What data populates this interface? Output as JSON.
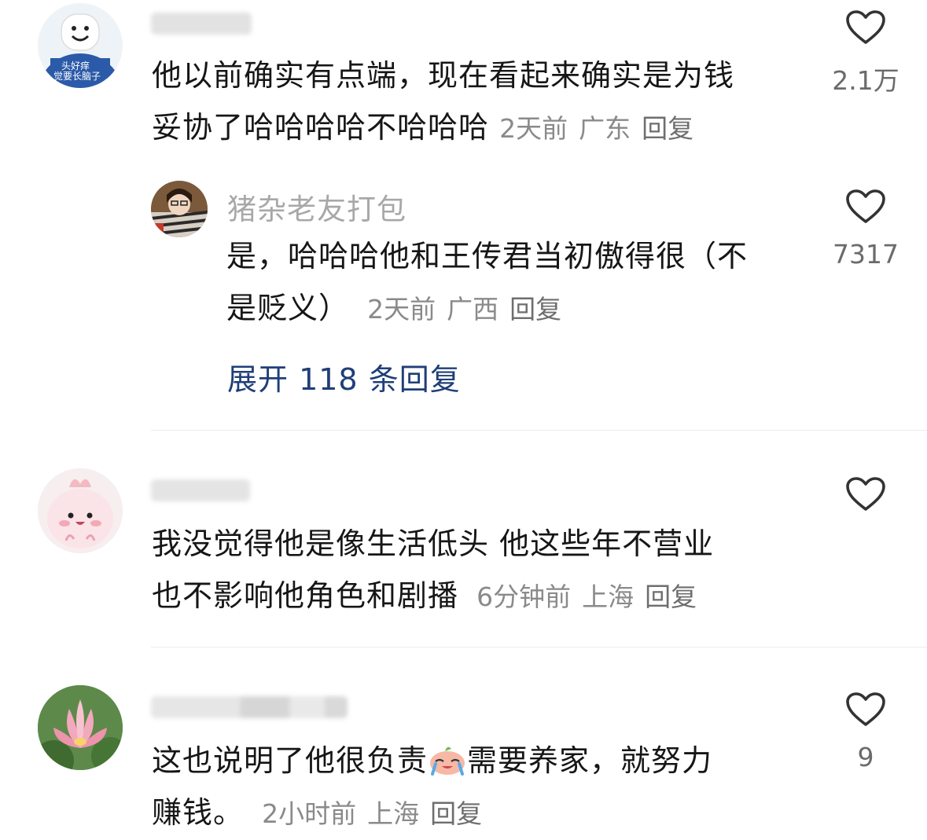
{
  "comments": [
    {
      "text_line1": "他以前确实有点端，现在看起来确实是为钱",
      "text_line2": "妥协了哈哈哈哈不哈哈哈",
      "time": "2天前",
      "location": "广东",
      "reply_label": "回复",
      "likes": "2.1万",
      "avatar_caption_1": "头好痒",
      "avatar_caption_2": "觉要长脑子",
      "sub_reply": {
        "username": "猪杂老友打包",
        "text_line1": "是，哈哈哈他和王传君当初傲得很（不",
        "text_line2": "是贬义）",
        "time": "2天前",
        "location": "广西",
        "reply_label": "回复",
        "likes": "7317"
      },
      "expand_label": "展开 118 条回复"
    },
    {
      "text_line1": "我没觉得他是像生活低头 他这些年不营业",
      "text_line2": "也不影响他角色和剧播",
      "time": "6分钟前",
      "location": "上海",
      "reply_label": "回复",
      "likes": ""
    },
    {
      "text_line1_before_emoji": "这也说明了他很负责",
      "text_line1_after_emoji": "需要养家，就努力",
      "text_line2": "赚钱。",
      "time": "2小时前",
      "location": "上海",
      "reply_label": "回复",
      "likes": "9",
      "emoji_name": "crying-face-emoji"
    }
  ],
  "icons": {
    "like": "heart-outline-icon"
  },
  "colors": {
    "expand_link": "#1f3f78",
    "meta_text": "#8a8a8a",
    "username": "#a8a8a8"
  }
}
